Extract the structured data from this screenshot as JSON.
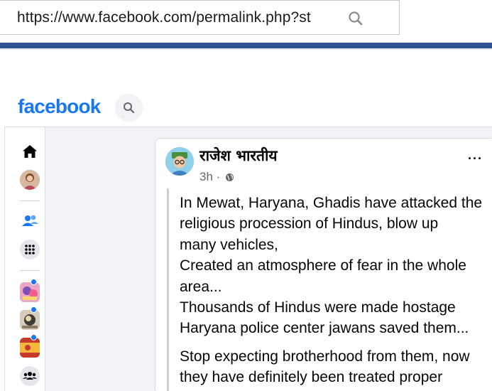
{
  "browser": {
    "url": "https://www.facebook.com/permalink.php?st",
    "search_icon": "search-icon"
  },
  "header": {
    "logo": "facebook",
    "search_icon": "search-icon"
  },
  "sidebar": {
    "items": [
      {
        "name": "home",
        "icon": "home-icon"
      },
      {
        "name": "profile",
        "icon": "avatar"
      },
      {
        "name": "friends",
        "icon": "friends-icon"
      },
      {
        "name": "menu",
        "icon": "grid-icon"
      },
      {
        "name": "shortcut-1",
        "icon": "group-thumbnail"
      },
      {
        "name": "shortcut-2",
        "icon": "group-thumbnail"
      },
      {
        "name": "shortcut-3",
        "icon": "group-thumbnail"
      },
      {
        "name": "groups",
        "icon": "groups-icon"
      }
    ]
  },
  "post": {
    "author": "राजेश भारतीय",
    "time": "3h ·",
    "privacy_icon": "globe-icon",
    "more_label": "···",
    "lines": [
      "In Mewat, Haryana, Ghadis have attacked the",
      "religious procession of Hindus, blow up",
      "many vehicles,",
      "Created an atmosphere of fear in the whole",
      "area...",
      "Thousands of Hindus were made hostage",
      "Haryana police center jawans saved them..."
    ],
    "lines2": [
      "Stop expecting brotherhood from them, now",
      "they have definitely been treated proper"
    ]
  },
  "colors": {
    "brand": "#1877f2",
    "band": "#2f4f93",
    "background": "#f0f2f5"
  }
}
